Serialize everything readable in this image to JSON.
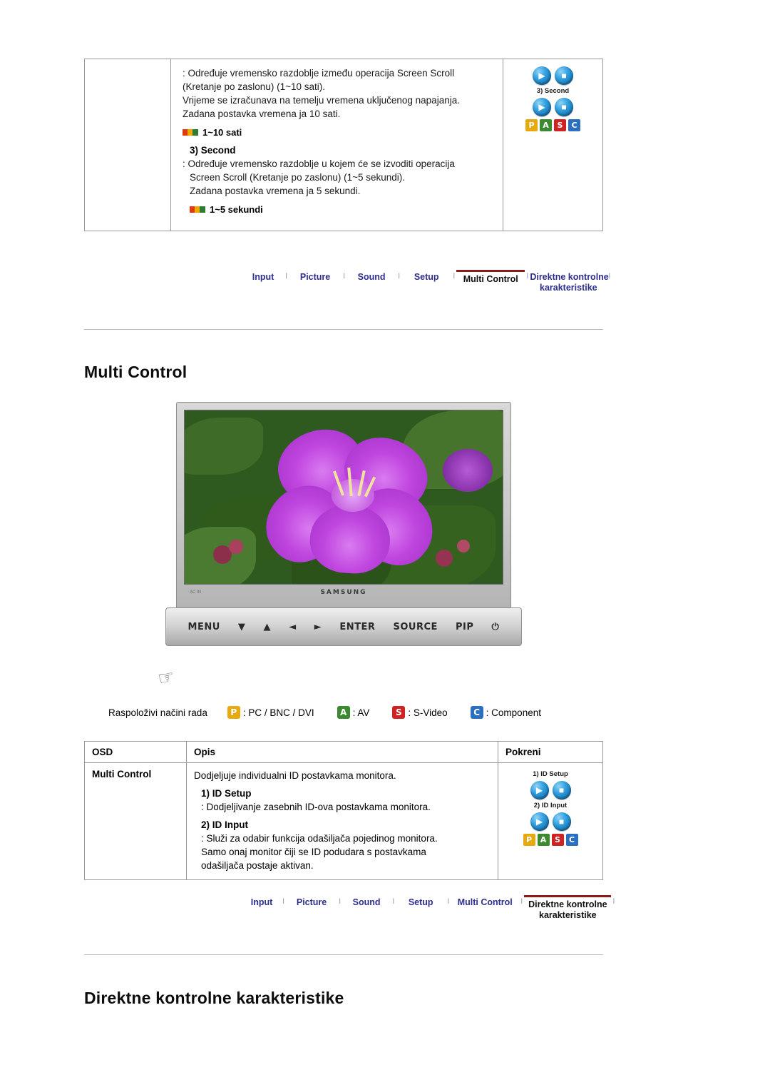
{
  "top_section": {
    "lines": [
      ": Određuje vremensko razdoblje između operacija Screen Scroll",
      "(Kretanje po zaslonu) (1~10 sati).",
      "Vrijeme se izračunava na temelju vremena uključenog napajanja.",
      "Zadana postavka vremena ja 10 sati."
    ],
    "range1": "1~10 sati",
    "subhead": "3) Second",
    "lines2": [
      ":  Određuje vremensko razdoblje u kojem će se izvoditi operacija",
      "Screen Scroll (Kretanje po zaslonu) (1~5 sekundi).",
      "Zadana postavka vremena ja 5 sekundi."
    ],
    "range2": "1~5 sekundi",
    "osd_label": "3) Second",
    "pasc": [
      "P",
      "A",
      "S",
      "C"
    ]
  },
  "nav1": {
    "items": [
      {
        "label": "Input",
        "active": false
      },
      {
        "label": "Picture",
        "active": false
      },
      {
        "label": "Sound",
        "active": false
      },
      {
        "label": "Setup",
        "active": false
      },
      {
        "label": "Multi Control",
        "active": true
      },
      {
        "label": "Direktne kontrolne",
        "label2": "karakteristike",
        "active": false
      }
    ],
    "separator": "I"
  },
  "page": {
    "title": "Multi Control"
  },
  "monitor": {
    "brand": "SAMSUNG",
    "left_mark": "AC IN",
    "controls": [
      "MENU",
      "▼",
      "▲",
      "◄",
      "►",
      "ENTER",
      "SOURCE",
      "PIP",
      "⏻"
    ]
  },
  "modes": {
    "label": "Raspoloživi načini rada",
    "items": [
      {
        "badge": "P",
        "text": ": PC / BNC / DVI"
      },
      {
        "badge": "A",
        "text": ": AV"
      },
      {
        "badge": "S",
        "text": ": S-Video"
      },
      {
        "badge": "C",
        "text": ": Component"
      }
    ]
  },
  "main_table": {
    "headers": [
      "OSD",
      "Opis",
      "Pokreni"
    ],
    "row": {
      "osd": "Multi Control",
      "desc_line1": "Dodjeljuje individualni ID postavkama monitora.",
      "sub1": "1) ID Setup",
      "desc_line2": ": Dodjeljivanje zasebnih ID-ova postavkama monitora.",
      "sub2": "2) ID Input",
      "desc_line3": ": Služi za odabir funkcija odašiljača pojedinog monitora.",
      "desc_line4": "Samo onaj monitor čiji se ID podudara s postavkama",
      "desc_line5": "odašiljača postaje aktivan.",
      "run_label1": "1) ID Setup",
      "run_label2": "2) ID Input",
      "pasc": [
        "P",
        "A",
        "S",
        "C"
      ]
    }
  },
  "nav2": {
    "items": [
      {
        "label": "Input",
        "active": false
      },
      {
        "label": "Picture",
        "active": false
      },
      {
        "label": "Sound",
        "active": false
      },
      {
        "label": "Setup",
        "active": false
      },
      {
        "label": "Multi Control",
        "active": false
      },
      {
        "label": "Direktne kontrolne",
        "label2": "karakteristike",
        "active": true
      }
    ],
    "separator": "I"
  },
  "footer": {
    "title": "Direktne kontrolne karakteristike"
  }
}
